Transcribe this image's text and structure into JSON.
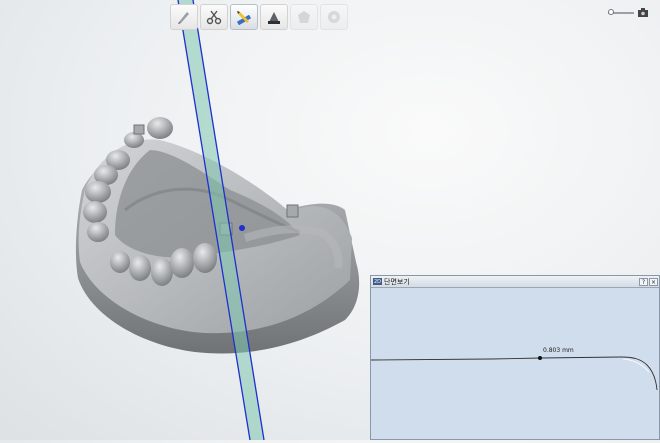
{
  "toolbar": {
    "tools": [
      {
        "icon": "pen-icon",
        "state": "normal"
      },
      {
        "icon": "scissors-icon",
        "state": "normal"
      },
      {
        "icon": "pencil-ruler-icon",
        "state": "active"
      },
      {
        "icon": "model-color-icon",
        "state": "normal"
      },
      {
        "icon": "shape-icon",
        "state": "disabled"
      },
      {
        "icon": "settings-icon",
        "state": "disabled"
      }
    ]
  },
  "cross_section_panel": {
    "badge": "2D",
    "title": "단면보기",
    "buttons": [
      "?",
      "×"
    ],
    "measurement": "0.803 mm"
  },
  "colors": {
    "plane_fill": "#7fc7b0",
    "plane_edge": "#1f2fd0",
    "panel_bg": "#cfdded",
    "model": "#9ea3a7"
  }
}
